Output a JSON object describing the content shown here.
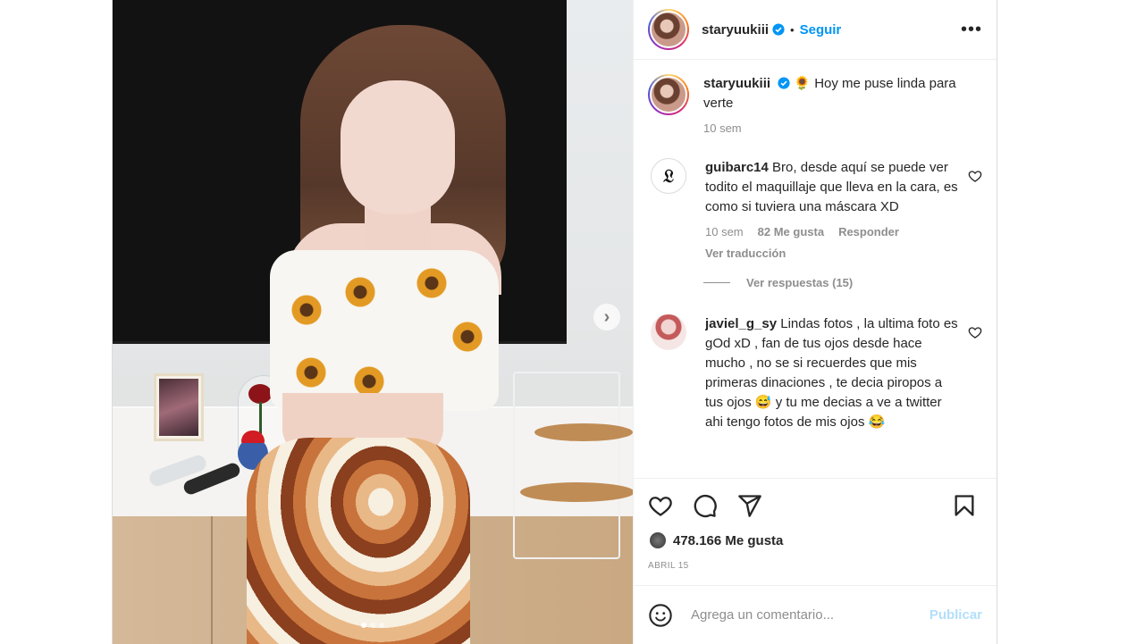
{
  "post": {
    "author": "staryuukiii",
    "follow_label": "Seguir",
    "separator": "•",
    "more_label": "•••",
    "caption": "🌻 Hoy me puse linda para verte",
    "caption_time": "10 sem",
    "slides": {
      "count": 3,
      "current": 1
    },
    "next_label": "›"
  },
  "comments": [
    {
      "user": "guibarc14",
      "text": "Bro, desde aquí se puede ver todito el maquillaje que lleva en la cara, es como si tuviera una máscara XD",
      "time": "10 sem",
      "likes": "82 Me gusta",
      "reply_label": "Responder",
      "translate_label": "Ver traducción",
      "view_replies": "Ver respuestas (15)"
    },
    {
      "user": "javiel_g_sy",
      "text": "Lindas fotos , la ultima foto es gOd xD , fan de tus ojos desde hace mucho , no se si recuerdes que mis primeras dinaciones , te decia piropos a tus ojos 😅 y tu me decias a ve a twitter ahi tengo fotos de mis ojos 😂"
    }
  ],
  "actions": {
    "likes": "478.166 Me gusta",
    "date": "ABRIL 15"
  },
  "add_comment": {
    "placeholder": "Agrega un comentario...",
    "publish_label": "Publicar"
  },
  "colors": {
    "accent": "#0095f6",
    "publish_disabled": "#b2dffc",
    "muted": "#8e8e8e",
    "text": "#262626"
  },
  "icons": [
    "verified-icon",
    "heart-icon",
    "comment-icon",
    "share-icon",
    "save-icon",
    "emoji-icon",
    "more-icon",
    "chevron-right-icon"
  ]
}
